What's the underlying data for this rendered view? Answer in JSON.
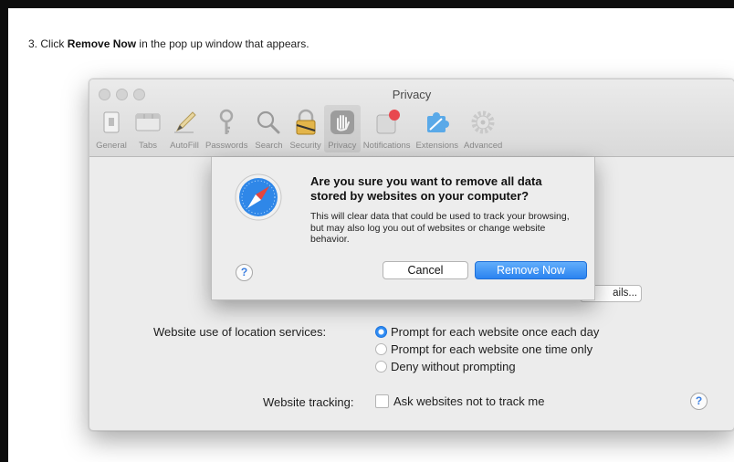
{
  "instruction": {
    "number": "3.",
    "text_before": "Click ",
    "emphasis": "Remove Now",
    "text_after": " in the pop up window that appears."
  },
  "window": {
    "title": "Privacy",
    "toolbar": [
      {
        "label": "General",
        "icon": "switch-icon"
      },
      {
        "label": "Tabs",
        "icon": "tabs-icon"
      },
      {
        "label": "AutoFill",
        "icon": "pencil-icon"
      },
      {
        "label": "Passwords",
        "icon": "key-icon"
      },
      {
        "label": "Search",
        "icon": "magnifier-icon"
      },
      {
        "label": "Security",
        "icon": "padlock-icon"
      },
      {
        "label": "Privacy",
        "icon": "hand-icon",
        "active": true
      },
      {
        "label": "Notifications",
        "icon": "notification-badge-icon"
      },
      {
        "label": "Extensions",
        "icon": "puzzle-icon"
      },
      {
        "label": "Advanced",
        "icon": "gear-icon"
      }
    ],
    "details_button": "ails...",
    "location": {
      "label": "Website use of location services:",
      "options": [
        {
          "label": "Prompt for each website once each day",
          "selected": true
        },
        {
          "label": "Prompt for each website one time only",
          "selected": false
        },
        {
          "label": "Deny without prompting",
          "selected": false
        }
      ]
    },
    "tracking": {
      "label": "Website tracking:",
      "checkbox_label": "Ask websites not to track me",
      "checked": false
    },
    "help_label": "?"
  },
  "dialog": {
    "title": "Are you sure you want to remove all data stored by websites on your computer?",
    "body": "This will clear data that could be used to track your browsing, but may also log you out of websites or change website behavior.",
    "help_label": "?",
    "cancel_label": "Cancel",
    "confirm_label": "Remove Now",
    "icon": "safari-compass-icon"
  },
  "colors": {
    "accent_blue": "#2b83f0",
    "radio_selected": "#2f8cf3",
    "notification_red": "#e8484f"
  }
}
